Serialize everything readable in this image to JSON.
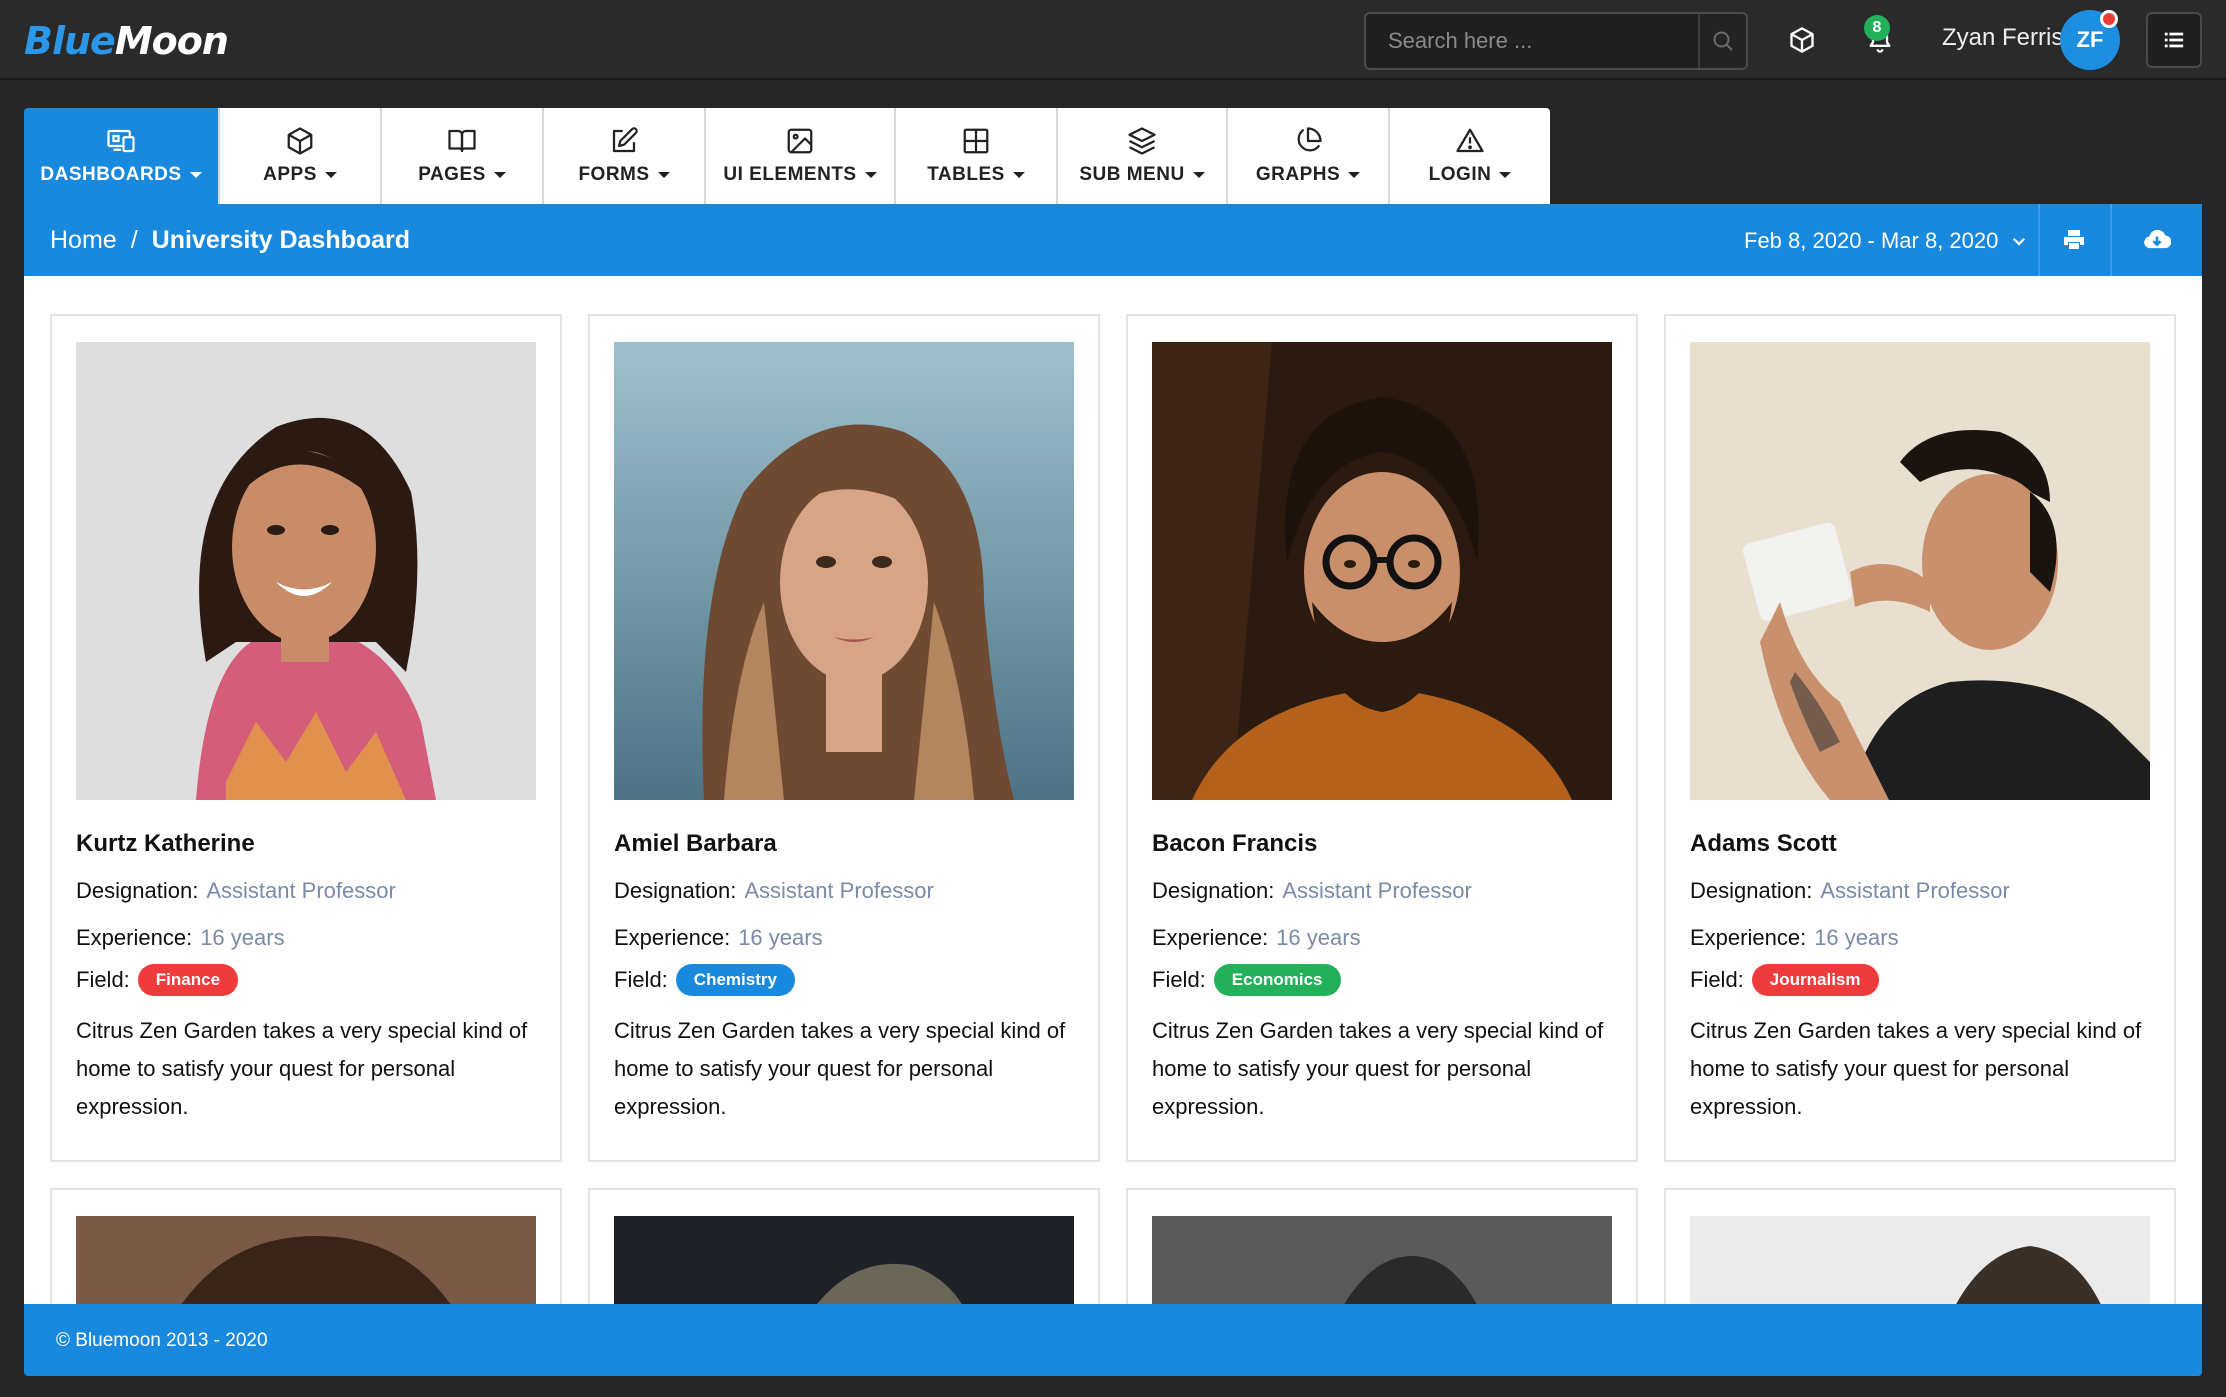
{
  "brand": {
    "part1": "Blue",
    "part2": "Moon"
  },
  "search": {
    "placeholder": "Search here ..."
  },
  "notifications": {
    "count": "8"
  },
  "user": {
    "name": "Zyan Ferris",
    "initials": "ZF"
  },
  "nav": [
    {
      "label": "DASHBOARDS",
      "icon": "dashboard-icon",
      "active": true
    },
    {
      "label": "APPS",
      "icon": "cube-icon"
    },
    {
      "label": "PAGES",
      "icon": "book-icon"
    },
    {
      "label": "FORMS",
      "icon": "edit-icon"
    },
    {
      "label": "UI ELEMENTS",
      "icon": "image-icon"
    },
    {
      "label": "TABLES",
      "icon": "grid-icon"
    },
    {
      "label": "SUB MENU",
      "icon": "layers-icon"
    },
    {
      "label": "GRAPHS",
      "icon": "pie-chart-icon"
    },
    {
      "label": "LOGIN",
      "icon": "alert-triangle-icon"
    }
  ],
  "breadcrumb": {
    "home": "Home",
    "separator": "/",
    "current": "University Dashboard"
  },
  "daterange": "Feb 8, 2020 - Mar 8, 2020",
  "labels": {
    "designation": "Designation:",
    "experience": "Experience:",
    "field": "Field:"
  },
  "cards": [
    {
      "name": "Kurtz Katherine",
      "designation": "Assistant Professor",
      "experience": "16 years",
      "field": "Finance",
      "field_color": "#ef3b3b",
      "description": "Citrus Zen Garden takes a very special kind of home to satisfy your quest for personal expression."
    },
    {
      "name": "Amiel Barbara",
      "designation": "Assistant Professor",
      "experience": "16 years",
      "field": "Chemistry",
      "field_color": "#1989de",
      "description": "Citrus Zen Garden takes a very special kind of home to satisfy your quest for personal expression."
    },
    {
      "name": "Bacon Francis",
      "designation": "Assistant Professor",
      "experience": "16 years",
      "field": "Economics",
      "field_color": "#22b05a",
      "description": "Citrus Zen Garden takes a very special kind of home to satisfy your quest for personal expression."
    },
    {
      "name": "Adams Scott",
      "designation": "Assistant Professor",
      "experience": "16 years",
      "field": "Journalism",
      "field_color": "#ef3b3b",
      "description": "Citrus Zen Garden takes a very special kind of home to satisfy your quest for personal expression."
    }
  ],
  "footer": "© Bluemoon 2013 - 2020",
  "colors": {
    "primary": "#1989de",
    "topbar": "#2a2a2a",
    "muted_value": "#7a8aa8"
  }
}
